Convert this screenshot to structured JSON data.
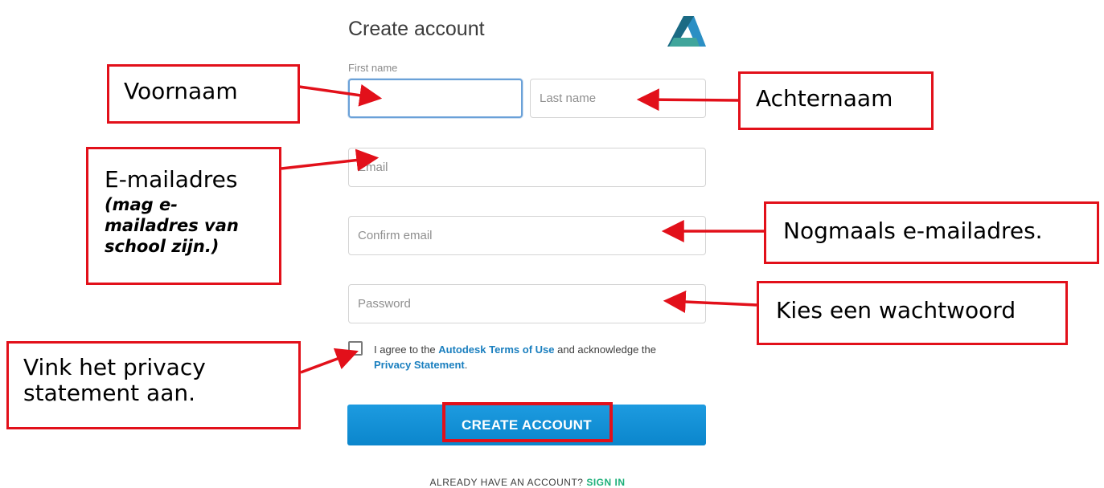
{
  "form": {
    "title": "Create account",
    "first_name_label": "First name",
    "first_name_value": "",
    "last_name_placeholder": "Last name",
    "email_placeholder": "Email",
    "confirm_email_placeholder": "Confirm email",
    "password_placeholder": "Password",
    "agree_prefix": "I agree to the",
    "terms_link": "Autodesk Terms of Use",
    "agree_middle": "and acknowledge the",
    "privacy_link": "Privacy Statement",
    "agree_suffix": ".",
    "create_button": "CREATE ACCOUNT",
    "already_text": "ALREADY HAVE AN ACCOUNT?",
    "sign_in_link": "SIGN IN"
  },
  "annotations": {
    "voornaam": "Voornaam",
    "achternaam": "Achternaam",
    "email_title": "E-mailadres",
    "email_note": "(mag e-mailadres van school zijn.)",
    "confirm": "Nogmaals e-mailadres.",
    "password": "Kies een wachtwoord",
    "privacy": "Vink het privacy statement aan."
  },
  "colors": {
    "annotation_red": "#e2101a",
    "button_blue": "#0b86cc",
    "link_blue": "#1a7fbf",
    "sign_in_green": "#1eb07a",
    "logo": [
      "#1b4d63",
      "#40a59b",
      "#2b8fc4"
    ]
  },
  "icons": {
    "logo": "autodesk-logo-icon"
  }
}
